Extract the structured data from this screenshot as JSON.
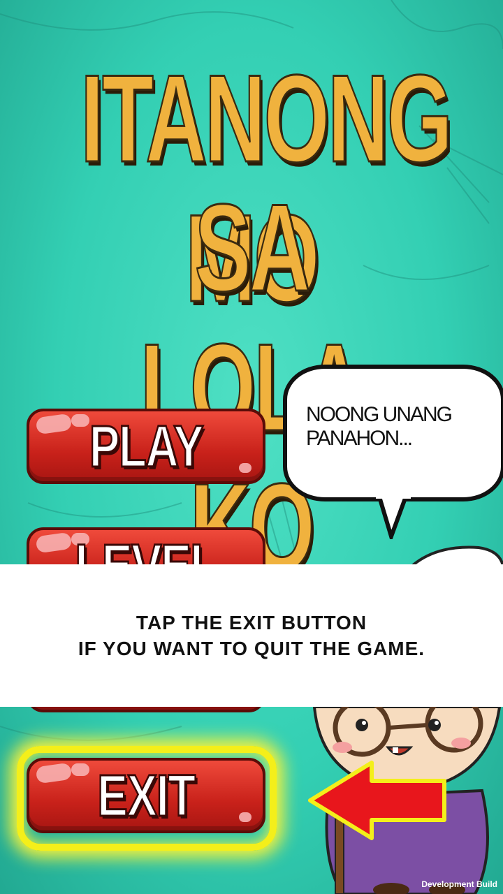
{
  "title": {
    "line1": "ITANONG MO",
    "line2": "SA LOLA KO"
  },
  "menu": {
    "play_label": "PLAY",
    "level_label": "LEVEL",
    "exit_label": "EXIT"
  },
  "speech_bubble": {
    "text": "NOONG UNANG PANAHON..."
  },
  "tutorial": {
    "line1": "TAP THE EXIT BUTTON",
    "line2": "IF YOU WANT TO QUIT THE GAME."
  },
  "footer": {
    "build_label": "Development Build"
  },
  "colors": {
    "background": "#33cfb3",
    "title": "#f0b23e",
    "button": "#d7261d",
    "highlight": "#f4ef1a",
    "arrow": "#e8161c"
  },
  "icons": {
    "pointer": "arrow-left-icon",
    "character": "grandmother-character"
  }
}
